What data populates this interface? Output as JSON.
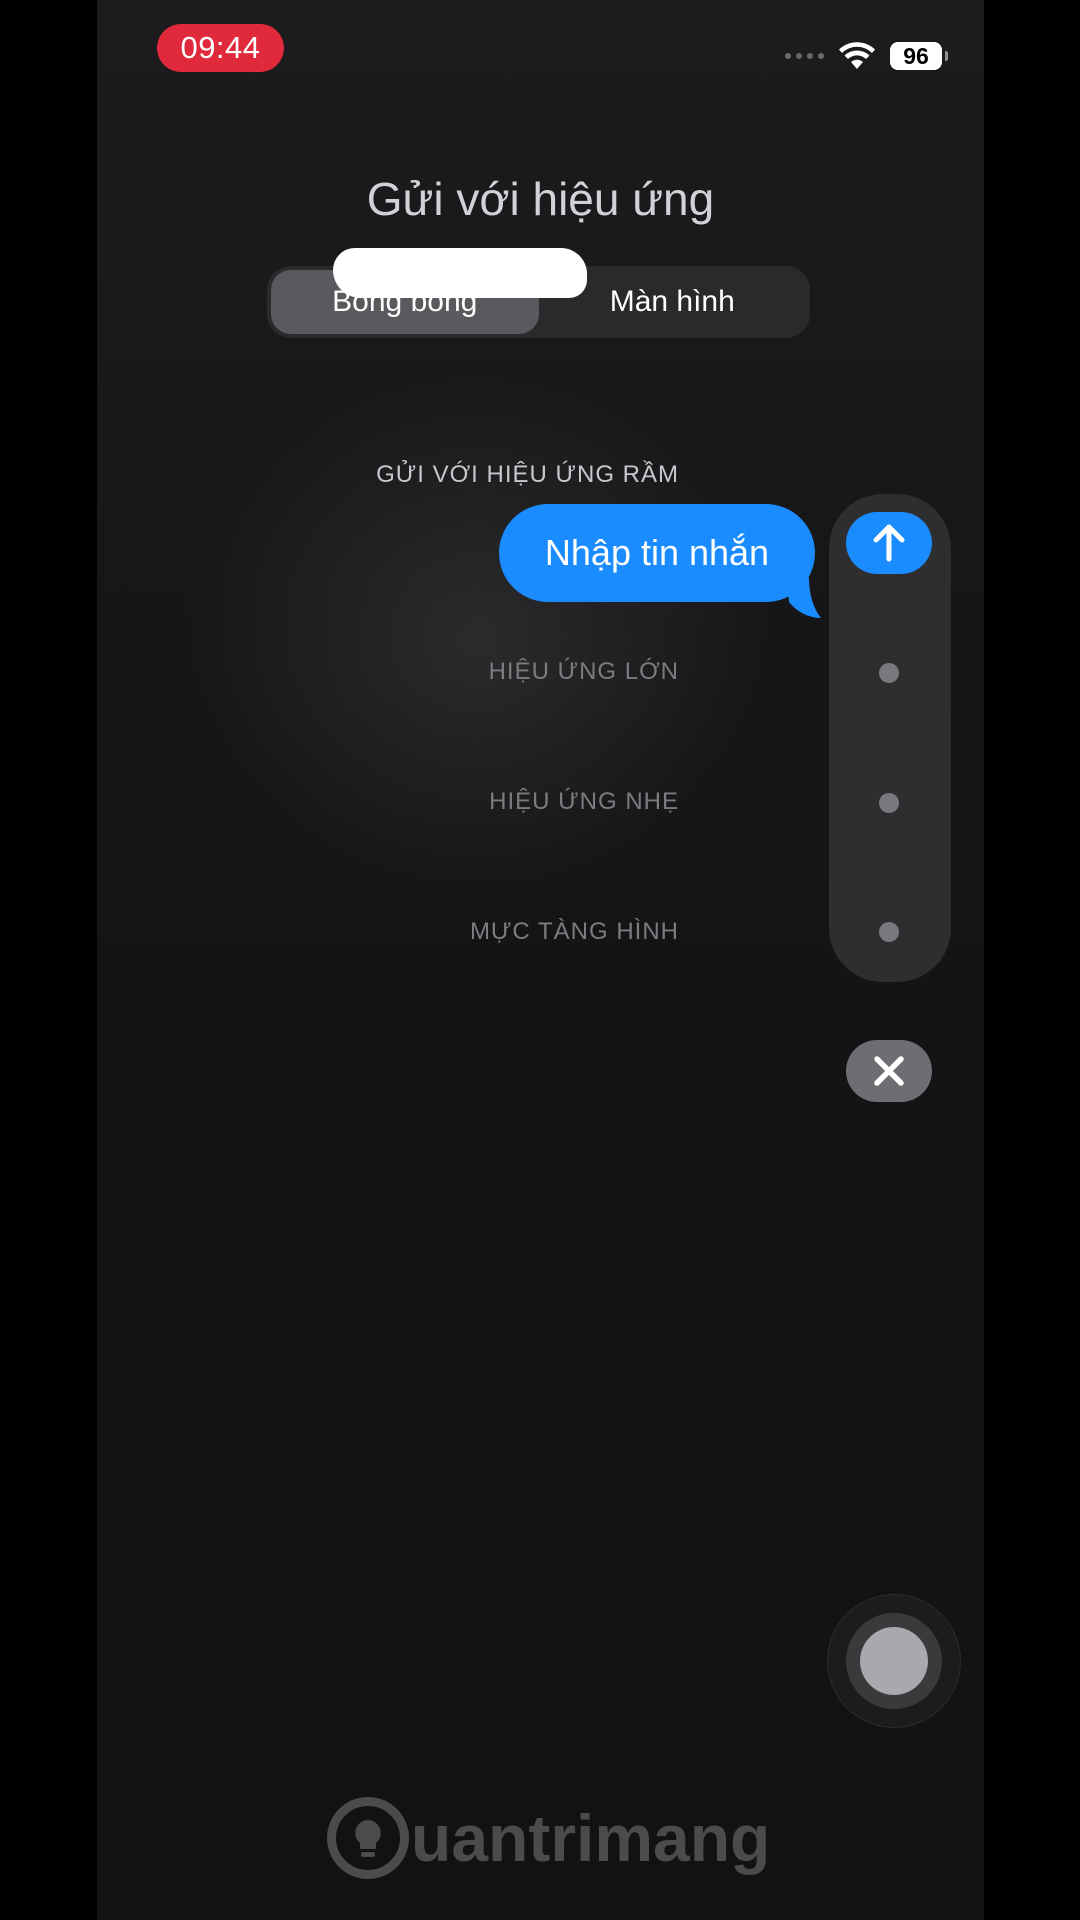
{
  "status_bar": {
    "time": "09:44",
    "battery": "96"
  },
  "sheet": {
    "title": "Gửi với hiệu ứng",
    "tabs": [
      {
        "label": "Bong bóng",
        "active": true
      },
      {
        "label": "Màn hình",
        "active": false
      }
    ]
  },
  "effects": {
    "selected_label": "GỬI VỚI HIỆU ỨNG RẦM",
    "options": [
      "HIỆU ỨNG LỚN",
      "HIỆU ỨNG NHẸ",
      "MỰC TÀNG HÌNH"
    ]
  },
  "message": {
    "text": "Nhập tin nhắn",
    "bubble_color": "#1a8cff"
  },
  "icons": {
    "send": "arrow-up-icon",
    "close": "close-icon",
    "wifi": "wifi-icon"
  },
  "watermark": {
    "text": "uantrimang"
  }
}
